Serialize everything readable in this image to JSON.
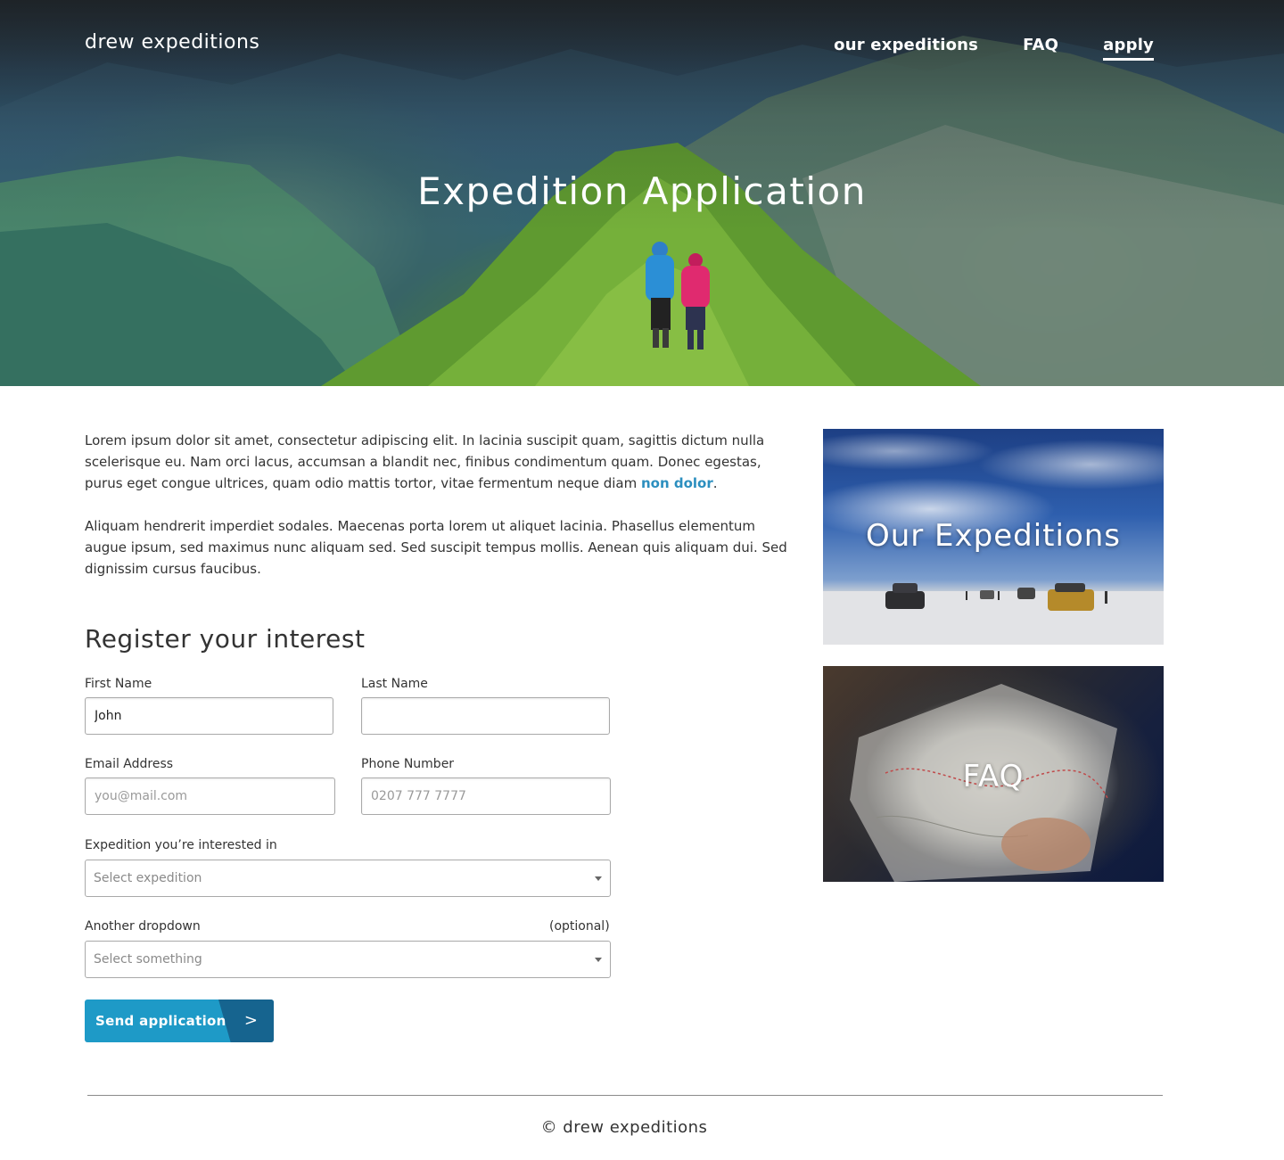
{
  "header": {
    "brand": "drew expeditions",
    "nav": [
      {
        "label": "our expeditions",
        "active": false
      },
      {
        "label": "FAQ",
        "active": false
      },
      {
        "label": "apply",
        "active": true
      }
    ]
  },
  "hero": {
    "title": "Expedition Application"
  },
  "intro": {
    "p1_text": "Lorem ipsum dolor sit amet, consectetur adipiscing elit. In lacinia suscipit quam, sagittis dictum nulla scelerisque eu. Nam orci lacus, accumsan a blandit nec, finibus condimentum quam. Donec egestas, purus eget congue ultrices, quam odio mattis tortor, vitae fermentum neque diam ",
    "p1_link": "non dolor",
    "p1_end": ".",
    "p2_text": "Aliquam hendrerit imperdiet sodales. Maecenas porta lorem ut aliquet lacinia. Phasellus elementum augue ipsum, sed maximus nunc aliquam sed. Sed suscipit tempus mollis. Aenean quis aliquam dui. Sed dignissim cursus faucibus."
  },
  "form": {
    "title": "Register your interest",
    "first_name": {
      "label": "First Name",
      "value": "John",
      "placeholder": ""
    },
    "last_name": {
      "label": "Last Name",
      "value": "",
      "placeholder": ""
    },
    "email": {
      "label": "Email Address",
      "value": "",
      "placeholder": "you@mail.com"
    },
    "phone": {
      "label": "Phone Number",
      "value": "",
      "placeholder": "0207 777 7777"
    },
    "expedition": {
      "label": "Expedition you’re interested in",
      "selected": "Select expedition"
    },
    "another": {
      "label": "Another dropdown",
      "optional": "(optional)",
      "selected": "Select something"
    },
    "submit_label": "Send application",
    "submit_chevron": ">"
  },
  "cards": {
    "expeditions": {
      "title": "Our Expeditions"
    },
    "faq": {
      "title": "FAQ"
    }
  },
  "footer": {
    "copyright": "© drew expeditions"
  },
  "colors": {
    "accent": "#1e9ac7",
    "accent_dark": "#16648f",
    "link": "#2c8fbf"
  }
}
